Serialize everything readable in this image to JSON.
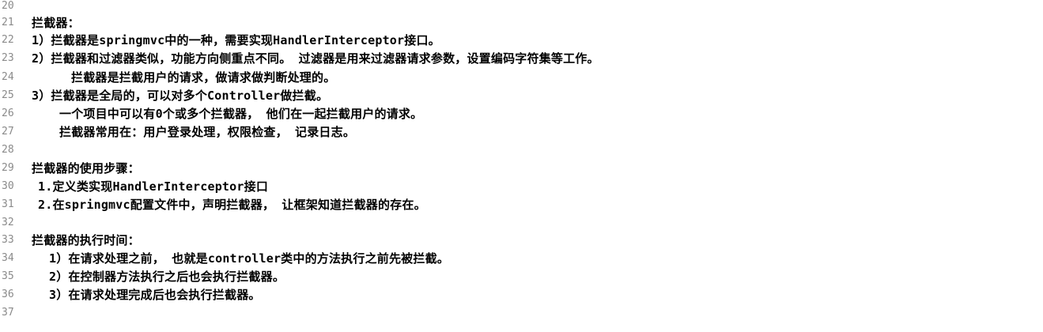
{
  "editor": {
    "lines": [
      {
        "number": "20",
        "text": ""
      },
      {
        "number": "21",
        "text": "拦截器："
      },
      {
        "number": "22",
        "text": "1）拦截器是springmvc中的一种，需要实现HandlerInterceptor接口。"
      },
      {
        "number": "23",
        "text": "2）拦截器和过滤器类似，功能方向侧重点不同。 过滤器是用来过滤器请求参数，设置编码字符集等工作。"
      },
      {
        "number": "24",
        "text": "拦截器是拦截用户的请求，做请求做判断处理的。"
      },
      {
        "number": "25",
        "text": "3）拦截器是全局的，可以对多个Controller做拦截。"
      },
      {
        "number": "26",
        "text": "一个项目中可以有0个或多个拦截器， 他们在一起拦截用户的请求。"
      },
      {
        "number": "27",
        "text": "拦截器常用在：用户登录处理，权限检查， 记录日志。"
      },
      {
        "number": "28",
        "text": ""
      },
      {
        "number": "29",
        "text": "拦截器的使用步骤："
      },
      {
        "number": "30",
        "text": "1.定义类实现HandlerInterceptor接口"
      },
      {
        "number": "31",
        "text": "2.在springmvc配置文件中，声明拦截器， 让框架知道拦截器的存在。"
      },
      {
        "number": "32",
        "text": ""
      },
      {
        "number": "33",
        "text": "拦截器的执行时间："
      },
      {
        "number": "34",
        "text": "1）在请求处理之前， 也就是controller类中的方法执行之前先被拦截。"
      },
      {
        "number": "35",
        "text": "2）在控制器方法执行之后也会执行拦截器。"
      },
      {
        "number": "36",
        "text": "3）在请求处理完成后也会执行拦截器。"
      },
      {
        "number": "37",
        "text": ""
      }
    ]
  }
}
